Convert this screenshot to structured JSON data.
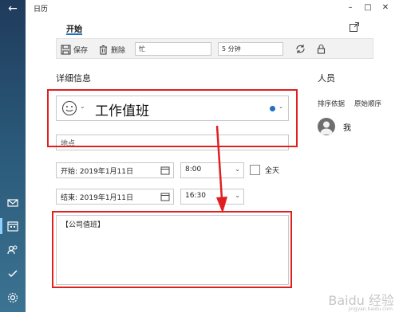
{
  "window": {
    "title": "日历"
  },
  "tabs": {
    "start": "开始"
  },
  "toolbar": {
    "save": "保存",
    "delete": "删除",
    "show_as": "忙",
    "reminder": "5 分钟"
  },
  "details": {
    "section_title": "详细信息",
    "event_title": "工作值班",
    "location_placeholder": "地点",
    "start_label": "开始:",
    "start_date": "2019年1月11日",
    "start_time": "8:00",
    "end_label": "结束:",
    "end_date": "2019年1月11日",
    "end_time": "16:30",
    "all_day": "全天",
    "notes": "【公司值班】"
  },
  "people": {
    "title": "人员",
    "sort_by": "排序依据",
    "original_order": "原始顺序",
    "me": "我"
  },
  "colors": {
    "calendar_accent": "#1f6fc5",
    "highlight_red": "#e02020"
  },
  "watermark": {
    "brand": "Baidu 经验",
    "url": "jingyan.baidu.com"
  }
}
